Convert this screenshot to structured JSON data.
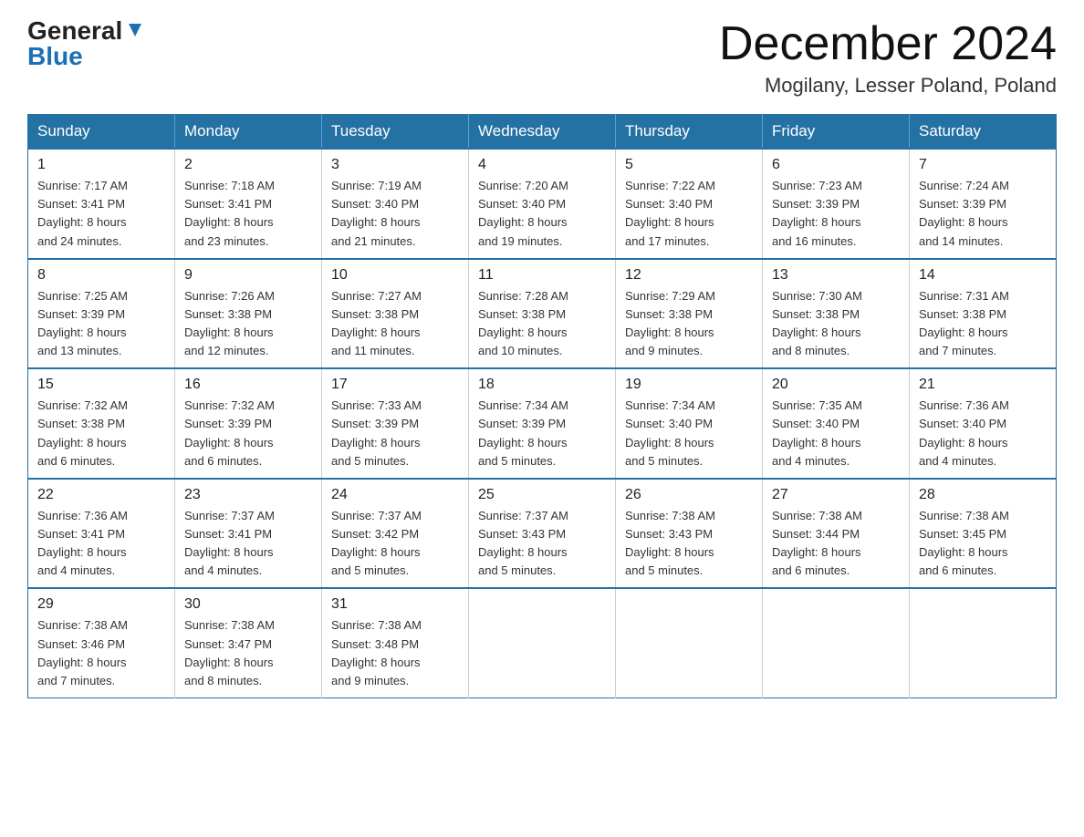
{
  "logo": {
    "general": "General",
    "blue": "Blue"
  },
  "title": {
    "month_year": "December 2024",
    "location": "Mogilany, Lesser Poland, Poland"
  },
  "weekdays": [
    "Sunday",
    "Monday",
    "Tuesday",
    "Wednesday",
    "Thursday",
    "Friday",
    "Saturday"
  ],
  "weeks": [
    [
      {
        "day": "1",
        "sunrise": "7:17 AM",
        "sunset": "3:41 PM",
        "daylight": "8 hours and 24 minutes."
      },
      {
        "day": "2",
        "sunrise": "7:18 AM",
        "sunset": "3:41 PM",
        "daylight": "8 hours and 23 minutes."
      },
      {
        "day": "3",
        "sunrise": "7:19 AM",
        "sunset": "3:40 PM",
        "daylight": "8 hours and 21 minutes."
      },
      {
        "day": "4",
        "sunrise": "7:20 AM",
        "sunset": "3:40 PM",
        "daylight": "8 hours and 19 minutes."
      },
      {
        "day": "5",
        "sunrise": "7:22 AM",
        "sunset": "3:40 PM",
        "daylight": "8 hours and 17 minutes."
      },
      {
        "day": "6",
        "sunrise": "7:23 AM",
        "sunset": "3:39 PM",
        "daylight": "8 hours and 16 minutes."
      },
      {
        "day": "7",
        "sunrise": "7:24 AM",
        "sunset": "3:39 PM",
        "daylight": "8 hours and 14 minutes."
      }
    ],
    [
      {
        "day": "8",
        "sunrise": "7:25 AM",
        "sunset": "3:39 PM",
        "daylight": "8 hours and 13 minutes."
      },
      {
        "day": "9",
        "sunrise": "7:26 AM",
        "sunset": "3:38 PM",
        "daylight": "8 hours and 12 minutes."
      },
      {
        "day": "10",
        "sunrise": "7:27 AM",
        "sunset": "3:38 PM",
        "daylight": "8 hours and 11 minutes."
      },
      {
        "day": "11",
        "sunrise": "7:28 AM",
        "sunset": "3:38 PM",
        "daylight": "8 hours and 10 minutes."
      },
      {
        "day": "12",
        "sunrise": "7:29 AM",
        "sunset": "3:38 PM",
        "daylight": "8 hours and 9 minutes."
      },
      {
        "day": "13",
        "sunrise": "7:30 AM",
        "sunset": "3:38 PM",
        "daylight": "8 hours and 8 minutes."
      },
      {
        "day": "14",
        "sunrise": "7:31 AM",
        "sunset": "3:38 PM",
        "daylight": "8 hours and 7 minutes."
      }
    ],
    [
      {
        "day": "15",
        "sunrise": "7:32 AM",
        "sunset": "3:38 PM",
        "daylight": "8 hours and 6 minutes."
      },
      {
        "day": "16",
        "sunrise": "7:32 AM",
        "sunset": "3:39 PM",
        "daylight": "8 hours and 6 minutes."
      },
      {
        "day": "17",
        "sunrise": "7:33 AM",
        "sunset": "3:39 PM",
        "daylight": "8 hours and 5 minutes."
      },
      {
        "day": "18",
        "sunrise": "7:34 AM",
        "sunset": "3:39 PM",
        "daylight": "8 hours and 5 minutes."
      },
      {
        "day": "19",
        "sunrise": "7:34 AM",
        "sunset": "3:40 PM",
        "daylight": "8 hours and 5 minutes."
      },
      {
        "day": "20",
        "sunrise": "7:35 AM",
        "sunset": "3:40 PM",
        "daylight": "8 hours and 4 minutes."
      },
      {
        "day": "21",
        "sunrise": "7:36 AM",
        "sunset": "3:40 PM",
        "daylight": "8 hours and 4 minutes."
      }
    ],
    [
      {
        "day": "22",
        "sunrise": "7:36 AM",
        "sunset": "3:41 PM",
        "daylight": "8 hours and 4 minutes."
      },
      {
        "day": "23",
        "sunrise": "7:37 AM",
        "sunset": "3:41 PM",
        "daylight": "8 hours and 4 minutes."
      },
      {
        "day": "24",
        "sunrise": "7:37 AM",
        "sunset": "3:42 PM",
        "daylight": "8 hours and 5 minutes."
      },
      {
        "day": "25",
        "sunrise": "7:37 AM",
        "sunset": "3:43 PM",
        "daylight": "8 hours and 5 minutes."
      },
      {
        "day": "26",
        "sunrise": "7:38 AM",
        "sunset": "3:43 PM",
        "daylight": "8 hours and 5 minutes."
      },
      {
        "day": "27",
        "sunrise": "7:38 AM",
        "sunset": "3:44 PM",
        "daylight": "8 hours and 6 minutes."
      },
      {
        "day": "28",
        "sunrise": "7:38 AM",
        "sunset": "3:45 PM",
        "daylight": "8 hours and 6 minutes."
      }
    ],
    [
      {
        "day": "29",
        "sunrise": "7:38 AM",
        "sunset": "3:46 PM",
        "daylight": "8 hours and 7 minutes."
      },
      {
        "day": "30",
        "sunrise": "7:38 AM",
        "sunset": "3:47 PM",
        "daylight": "8 hours and 8 minutes."
      },
      {
        "day": "31",
        "sunrise": "7:38 AM",
        "sunset": "3:48 PM",
        "daylight": "8 hours and 9 minutes."
      },
      null,
      null,
      null,
      null
    ]
  ],
  "labels": {
    "sunrise": "Sunrise:",
    "sunset": "Sunset:",
    "daylight": "Daylight:"
  }
}
